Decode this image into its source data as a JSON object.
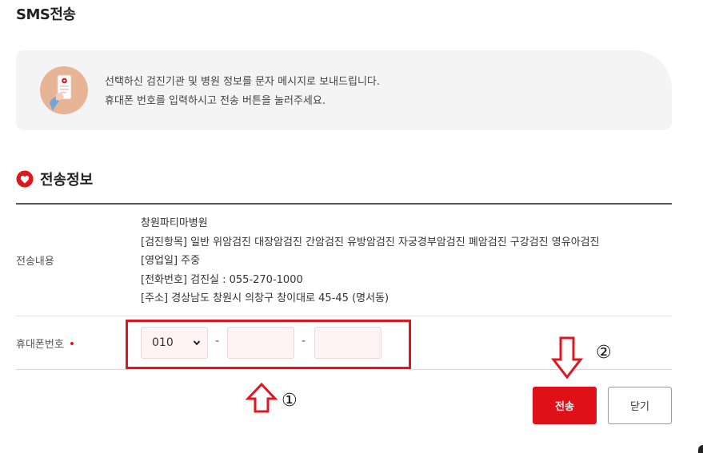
{
  "page": {
    "title": "SMS전송"
  },
  "info": {
    "line1": "선택하신 검진기관 및 병원 정보를 문자 메시지로 보내드립니다.",
    "line2": "휴대폰 번호를 입력하시고 전송 버튼을 눌러주세요."
  },
  "section": {
    "title": "전송정보"
  },
  "content": {
    "label": "전송내용",
    "lines": [
      "창원파티마병원",
      "[검진항목] 일반 위암검진 대장암검진 간암검진 유방암검진 자궁경부암검진 폐암검진 구강검진 영유아검진",
      "[영업일] 주중",
      "[전화번호] 검진실 : 055-270-1000",
      "[주소] 경상남도 창원시 의창구 창이대로 45-45 (명서동)"
    ]
  },
  "phone": {
    "label": "휴대폰번호",
    "required_mark": "•",
    "prefix_value": "010",
    "separator": "-",
    "middle_value": "",
    "last_value": ""
  },
  "buttons": {
    "send_label": "전송",
    "close_label": "닫기"
  },
  "annotations": {
    "step1": "①",
    "step2": "②"
  },
  "colors": {
    "accent": "#e01019",
    "input_bg": "#fff3f3",
    "info_bg": "#f4f4f4"
  },
  "icons": {
    "info": "phone-in-hand-icon",
    "section": "heart-pin-icon",
    "select": "chevron-down-icon"
  }
}
